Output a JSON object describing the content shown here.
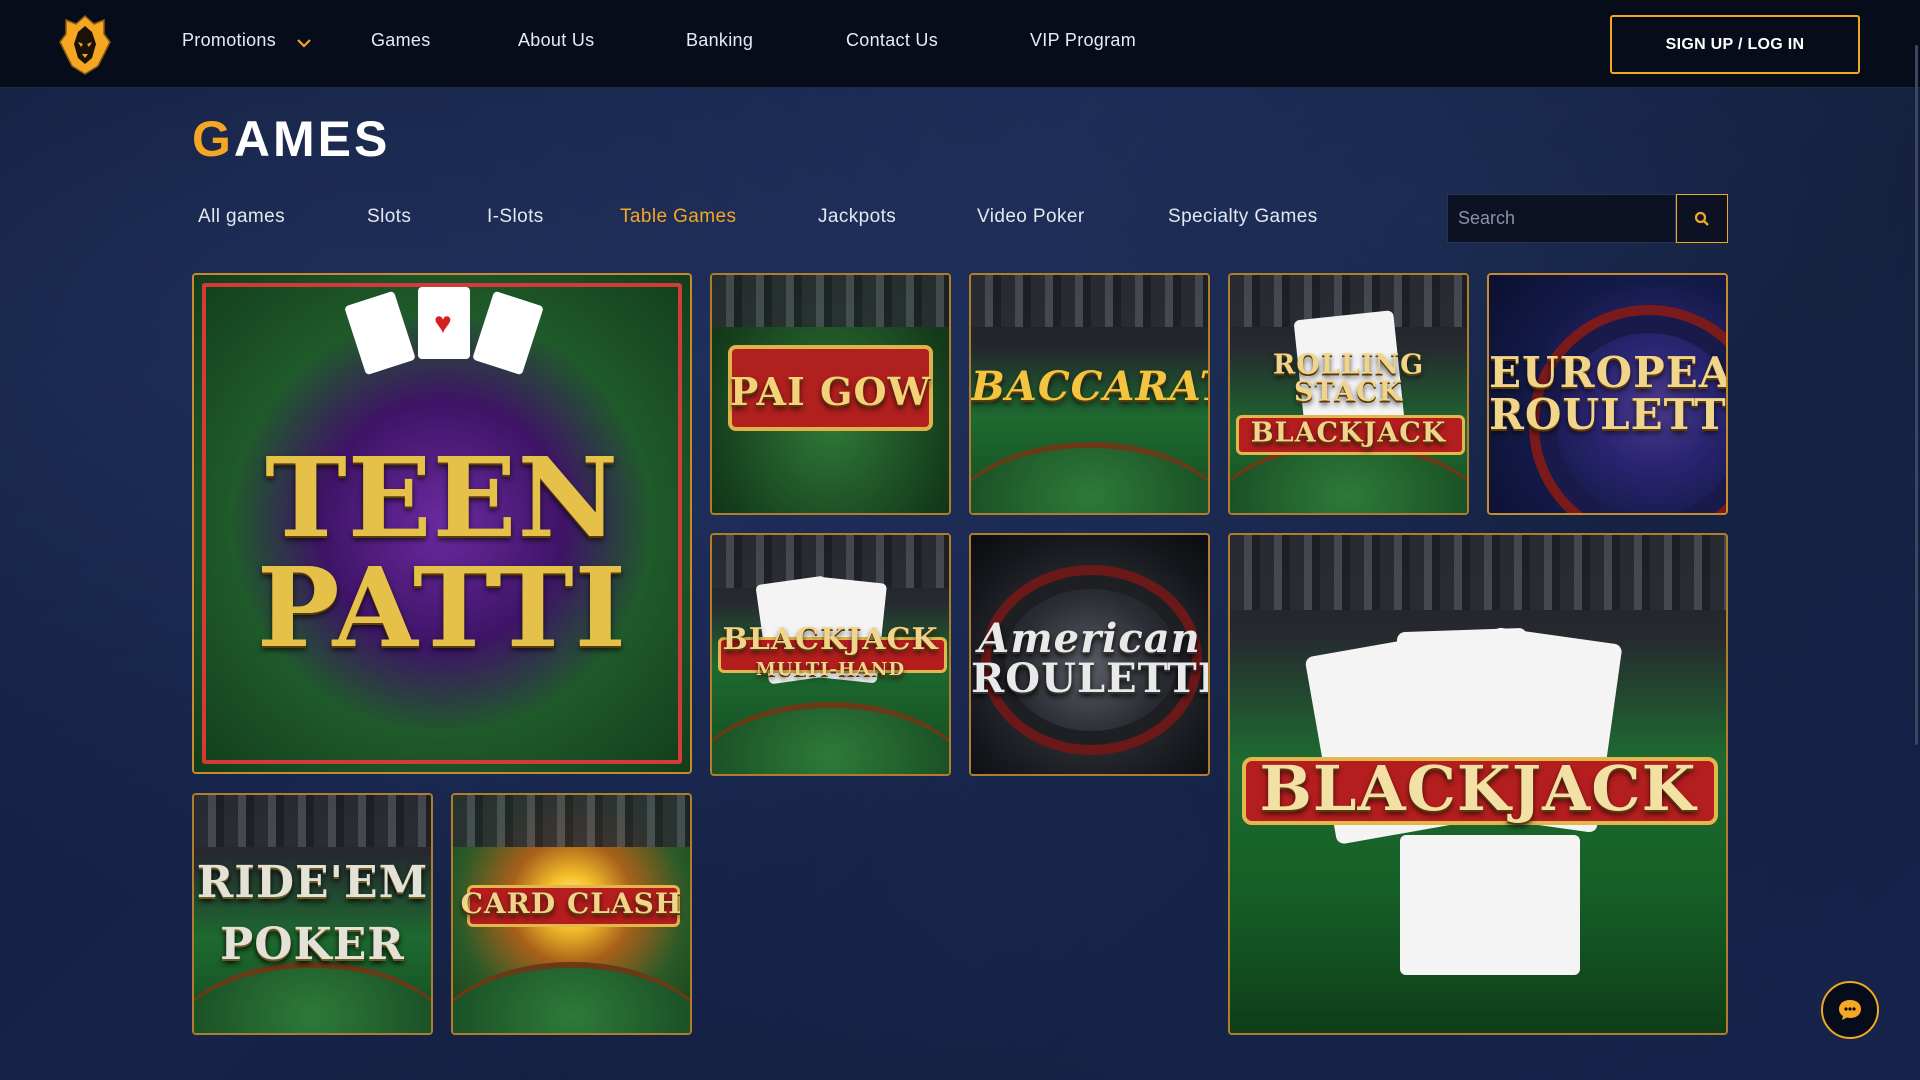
{
  "header": {
    "logo_icon": "lion-head-icon",
    "nav": [
      {
        "label": "Promotions",
        "has_dropdown": true
      },
      {
        "label": "Games"
      },
      {
        "label": "About Us"
      },
      {
        "label": "Banking"
      },
      {
        "label": "Contact Us"
      },
      {
        "label": "VIP Program"
      }
    ],
    "signup_label": "SIGN UP / LOG IN"
  },
  "page": {
    "title_first": "G",
    "title_rest": "AMES"
  },
  "tabs": [
    {
      "label": "All games",
      "active": false
    },
    {
      "label": "Slots",
      "active": false
    },
    {
      "label": "I-Slots",
      "active": false
    },
    {
      "label": "Table Games",
      "active": true
    },
    {
      "label": "Jackpots",
      "active": false
    },
    {
      "label": "Video Poker",
      "active": false
    },
    {
      "label": "Specialty Games",
      "active": false
    }
  ],
  "search": {
    "placeholder": "Search",
    "value": "",
    "button_icon": "search-icon"
  },
  "games": [
    {
      "title": "TEEN PATTI",
      "line1": "TEEN",
      "line2": "PATTI"
    },
    {
      "title": "PAI GOW",
      "line1": "PAI GOW",
      "line2": ""
    },
    {
      "title": "BACCARAT",
      "line1": "BACCARAT",
      "line2": ""
    },
    {
      "title": "ROLLING STACK BLACKJACK",
      "line1": "ROLLING STACK",
      "line2": "BLACKJACK"
    },
    {
      "title": "EUROPEAN ROULETTE",
      "line1": "EUROPEAN",
      "line2": "ROULETTE"
    },
    {
      "title": "BLACKJACK MULTI-HAND",
      "line1": "BLACKJACK",
      "line2": "MULTI-HAND"
    },
    {
      "title": "American ROULETTE",
      "line1": "American",
      "line2": "ROULETTE"
    },
    {
      "title": "BLACKJACK",
      "line1": "BLACKJACK",
      "line2": ""
    },
    {
      "title": "RIDE'EM POKER",
      "line1": "RIDE'EM",
      "line2": "POKER"
    },
    {
      "title": "CARD CLASH",
      "line1": "CARD CLASH",
      "line2": ""
    }
  ],
  "chat_icon": "chat-bubble-icon",
  "colors": {
    "accent": "#f5a623",
    "header_bg": "#060c1a",
    "page_bg": "#13204a",
    "tile_border": "#b07d2a"
  }
}
